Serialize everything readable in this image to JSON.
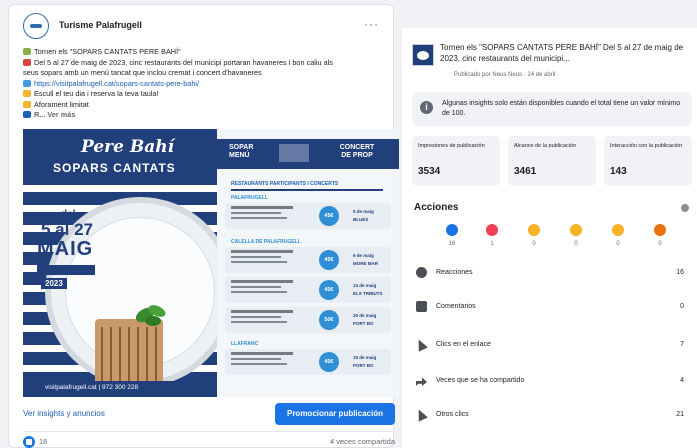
{
  "post": {
    "page_name": "Turisme Palafrugell",
    "more": "···",
    "caption_lines": [
      "Tornen els \"SOPARS CANTATS PERE BAHÍ\"",
      "Del 5 al 27 de maig de 2023, cinc restaurants del municipi portaran havaneres i bon caliu als",
      "seus sopars amb un menú tancat que inclou cremat i concert d'havaneres",
      "https://visitpalafrugell.cat/sopars-cantats-pere-bahi/",
      "Escull el teu dia i reserva la teva taula!",
      "Aforament limitat",
      "R... Ver más"
    ],
    "emoji_colors": [
      "#8bb04a",
      "#d9453c",
      "#c9c9c9",
      "#3f9ae0",
      "#f2b632",
      "#f2b632",
      "#1d5fb4"
    ],
    "poster": {
      "title1": "Pere Bahí",
      "title2": "SOPARS CANTATS",
      "date_del": "del",
      "date_range": "5 al 27",
      "date_month": "MAIG",
      "date_year": "2023",
      "footer": "visitpalafrugell.cat  |  972 300 228",
      "menu_label": "SOPAR MENÚ",
      "concert_label": "CONCERT DE PROP",
      "section_title": "RESTAURANTS PARTICIPANTS I CONCERTS",
      "section1": "PALAFRUGELL",
      "section2": "CALELLA DE PALAFRUGELL",
      "section3": "LLAFRANC",
      "boxes": [
        {
          "circle": "45€",
          "date": "5 de maig",
          "group": "BLUES"
        },
        {
          "circle": "45€",
          "date": "6 de maig",
          "group": "MORE MAR"
        },
        {
          "circle": "45€",
          "date": "13 de maig",
          "group": "ELS TRIBUTS"
        },
        {
          "circle": "50€",
          "date": "20 de maig",
          "group": "PORT BO"
        },
        {
          "circle": "45€",
          "date": "19 de maig",
          "group": "PORT BO"
        }
      ]
    },
    "insights_link": "Ver insights y anuncios",
    "promote_button": "Promocionar publicación",
    "like_count": "16",
    "shares": "4 veces compartida"
  },
  "panel": {
    "title": "Tornen els \"SOPARS CANTATS PERE BAHÍ\" Del 5 al 27 de maig de 2023, cinc restaurants del municipi...",
    "subtitle": "Publicado por Neus Neus · 24 de abril · ",
    "info": "Algunas insights solo están disponibles cuando el total tiene un valor mínimo de 100.",
    "metrics": [
      {
        "label": "Impresiones de publicación",
        "value": "3534"
      },
      {
        "label": "Alcance de la publicación",
        "value": "3461"
      },
      {
        "label": "Interacción con la publicación",
        "value": "143"
      }
    ],
    "actions_title": "Acciones",
    "reactions": [
      {
        "name": "like",
        "color": "#1b74e4",
        "count": "16"
      },
      {
        "name": "love",
        "color": "#f33e58",
        "count": "1"
      },
      {
        "name": "haha",
        "color": "#f7b125",
        "count": "0"
      },
      {
        "name": "wow",
        "color": "#f7b125",
        "count": "0"
      },
      {
        "name": "sad",
        "color": "#f7b125",
        "count": "0"
      },
      {
        "name": "angry",
        "color": "#e9710f",
        "count": "0"
      }
    ],
    "rows": [
      {
        "icon": "face",
        "label": "Reacciones",
        "count": "16"
      },
      {
        "icon": "bubble",
        "label": "Comentarios",
        "count": "0"
      },
      {
        "icon": "cursor",
        "label": "Clics en el enlace",
        "count": "7"
      },
      {
        "icon": "share",
        "label": "Veces que se ha compartido",
        "count": "4"
      },
      {
        "icon": "cursor",
        "label": "Otros clics",
        "count": "21"
      }
    ]
  }
}
